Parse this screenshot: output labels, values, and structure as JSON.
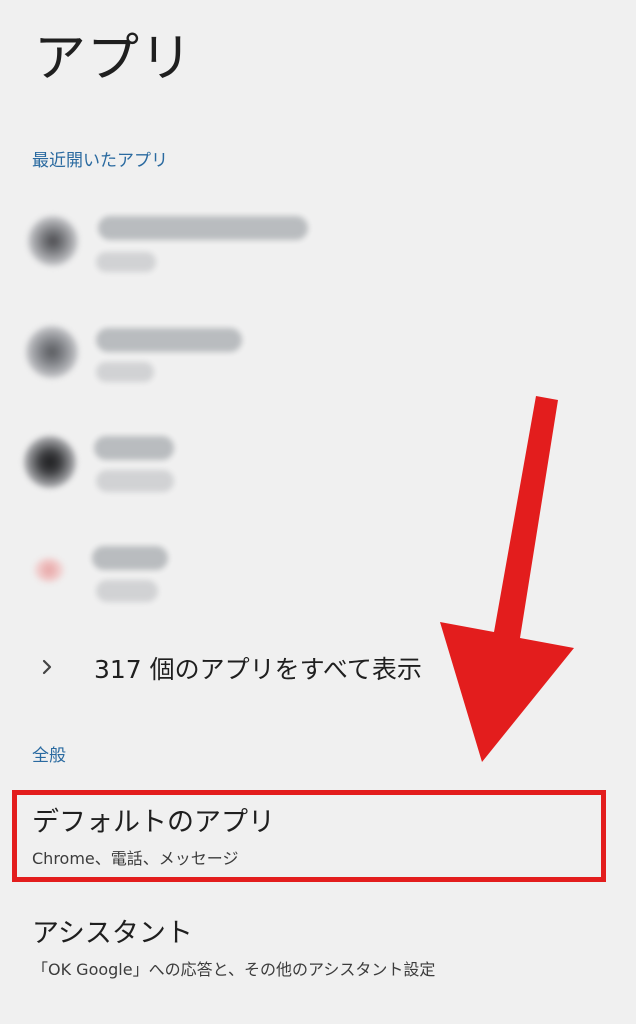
{
  "header": {
    "title": "アプリ"
  },
  "recent": {
    "section_label": "最近開いたアプリ",
    "items": [
      {
        "icon": "blurred-app-icon"
      },
      {
        "icon": "blurred-app-icon"
      },
      {
        "icon": "blurred-app-icon"
      },
      {
        "icon": "blurred-app-icon"
      }
    ]
  },
  "see_all": {
    "label": "317 個のアプリをすべて表示",
    "icon": "chevron-right-icon"
  },
  "general": {
    "section_label": "全般",
    "items": [
      {
        "title": "デフォルトのアプリ",
        "subtitle": "Chrome、電話、メッセージ"
      },
      {
        "title": "アシスタント",
        "subtitle": "「OK Google」への応答と、その他のアシスタント設定"
      }
    ]
  },
  "annotation": {
    "highlight_color": "#e31d1d",
    "arrow_color": "#e31d1d"
  }
}
